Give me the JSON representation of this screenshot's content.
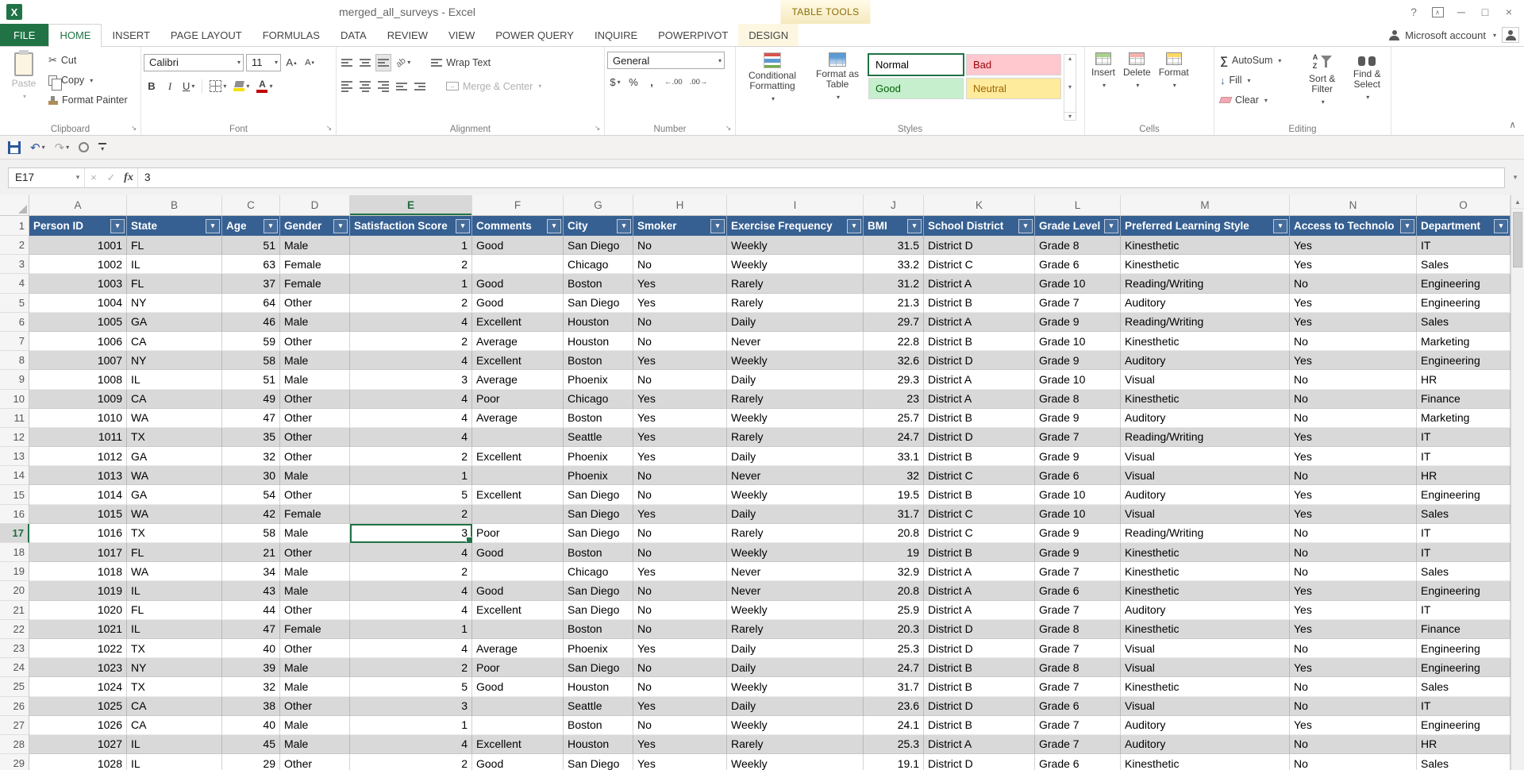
{
  "window": {
    "title": "merged_all_surveys - Excel",
    "context_header": "TABLE TOOLS"
  },
  "account_label": "Microsoft account",
  "tabs": {
    "file": "FILE",
    "items": [
      {
        "label": "HOME",
        "active": true
      },
      {
        "label": "INSERT"
      },
      {
        "label": "PAGE LAYOUT"
      },
      {
        "label": "FORMULAS"
      },
      {
        "label": "DATA"
      },
      {
        "label": "REVIEW"
      },
      {
        "label": "VIEW"
      },
      {
        "label": "POWER QUERY"
      },
      {
        "label": "INQUIRE"
      },
      {
        "label": "POWERPIVOT"
      },
      {
        "label": "DESIGN",
        "contextual": true
      }
    ]
  },
  "ribbon": {
    "clipboard": {
      "label": "Clipboard",
      "paste": "Paste",
      "cut": "Cut",
      "copy": "Copy",
      "format_painter": "Format Painter"
    },
    "font": {
      "label": "Font",
      "family": "Calibri",
      "size": "11",
      "bold": "B",
      "italic": "I",
      "underline": "U"
    },
    "alignment": {
      "label": "Alignment",
      "wr2": "",
      "wrap_text": "Wrap Text",
      "merge_center": "Merge & Center"
    },
    "number": {
      "label": "Number",
      "format": "General"
    },
    "styles": {
      "label": "Styles",
      "conditional": "Conditional Formatting",
      "format_table": "Format as Table",
      "gallery": [
        {
          "name": "Normal",
          "selected": true
        },
        {
          "name": "Bad"
        },
        {
          "name": "Good"
        },
        {
          "name": "Neutral"
        }
      ]
    },
    "cells": {
      "label": "Cells",
      "insert": "Insert",
      "delete": "Delete",
      "format": "Format"
    },
    "editing": {
      "label": "Editing",
      "autosum": "AutoSum",
      "fill": "Fill",
      "clear": "Clear",
      "sort_filter": "Sort & Filter",
      "find_select": "Find & Select"
    }
  },
  "formula_bar": {
    "name_box": "E17",
    "fx": "fx",
    "content": "3"
  },
  "sheet": {
    "col_letters": [
      "A",
      "B",
      "C",
      "D",
      "E",
      "F",
      "G",
      "H",
      "I",
      "J",
      "K",
      "L",
      "M",
      "N",
      "O"
    ],
    "selected_col": "E",
    "selected_row": 17,
    "table": {
      "headers": [
        "Person ID",
        "State",
        "Age",
        "Gender",
        "Satisfaction Score",
        "Comments",
        "City",
        "Smoker",
        "Exercise Frequency",
        "BMI",
        "School District",
        "Grade Level",
        "Preferred Learning Style",
        "Access to Technolo",
        "Department"
      ],
      "rows": [
        [
          1001,
          "FL",
          51,
          "Male",
          1,
          "Good",
          "San Diego",
          "No",
          "Weekly",
          31.5,
          "District D",
          "Grade 8",
          "Kinesthetic",
          "Yes",
          "IT"
        ],
        [
          1002,
          "IL",
          63,
          "Female",
          2,
          "",
          "Chicago",
          "No",
          "Weekly",
          33.2,
          "District C",
          "Grade 6",
          "Kinesthetic",
          "Yes",
          "Sales"
        ],
        [
          1003,
          "FL",
          37,
          "Female",
          1,
          "Good",
          "Boston",
          "Yes",
          "Rarely",
          31.2,
          "District A",
          "Grade 10",
          "Reading/Writing",
          "No",
          "Engineering"
        ],
        [
          1004,
          "NY",
          64,
          "Other",
          2,
          "Good",
          "San Diego",
          "Yes",
          "Rarely",
          21.3,
          "District B",
          "Grade 7",
          "Auditory",
          "Yes",
          "Engineering"
        ],
        [
          1005,
          "GA",
          46,
          "Male",
          4,
          "Excellent",
          "Houston",
          "No",
          "Daily",
          29.7,
          "District A",
          "Grade 9",
          "Reading/Writing",
          "Yes",
          "Sales"
        ],
        [
          1006,
          "CA",
          59,
          "Other",
          2,
          "Average",
          "Houston",
          "No",
          "Never",
          22.8,
          "District B",
          "Grade 10",
          "Kinesthetic",
          "No",
          "Marketing"
        ],
        [
          1007,
          "NY",
          58,
          "Male",
          4,
          "Excellent",
          "Boston",
          "Yes",
          "Weekly",
          32.6,
          "District D",
          "Grade 9",
          "Auditory",
          "Yes",
          "Engineering"
        ],
        [
          1008,
          "IL",
          51,
          "Male",
          3,
          "Average",
          "Phoenix",
          "No",
          "Daily",
          29.3,
          "District A",
          "Grade 10",
          "Visual",
          "No",
          "HR"
        ],
        [
          1009,
          "CA",
          49,
          "Other",
          4,
          "Poor",
          "Chicago",
          "Yes",
          "Rarely",
          23,
          "District A",
          "Grade 8",
          "Kinesthetic",
          "No",
          "Finance"
        ],
        [
          1010,
          "WA",
          47,
          "Other",
          4,
          "Average",
          "Boston",
          "Yes",
          "Weekly",
          25.7,
          "District B",
          "Grade 9",
          "Auditory",
          "No",
          "Marketing"
        ],
        [
          1011,
          "TX",
          35,
          "Other",
          4,
          "",
          "Seattle",
          "Yes",
          "Rarely",
          24.7,
          "District D",
          "Grade 7",
          "Reading/Writing",
          "Yes",
          "IT"
        ],
        [
          1012,
          "GA",
          32,
          "Other",
          2,
          "Excellent",
          "Phoenix",
          "Yes",
          "Daily",
          33.1,
          "District B",
          "Grade 9",
          "Visual",
          "Yes",
          "IT"
        ],
        [
          1013,
          "WA",
          30,
          "Male",
          1,
          "",
          "Phoenix",
          "No",
          "Never",
          32,
          "District C",
          "Grade 6",
          "Visual",
          "No",
          "HR"
        ],
        [
          1014,
          "GA",
          54,
          "Other",
          5,
          "Excellent",
          "San Diego",
          "No",
          "Weekly",
          19.5,
          "District B",
          "Grade 10",
          "Auditory",
          "Yes",
          "Engineering"
        ],
        [
          1015,
          "WA",
          42,
          "Female",
          2,
          "",
          "San Diego",
          "Yes",
          "Daily",
          31.7,
          "District C",
          "Grade 10",
          "Visual",
          "Yes",
          "Sales"
        ],
        [
          1016,
          "TX",
          58,
          "Male",
          3,
          "Poor",
          "San Diego",
          "No",
          "Rarely",
          20.8,
          "District C",
          "Grade 9",
          "Reading/Writing",
          "No",
          "IT"
        ],
        [
          1017,
          "FL",
          21,
          "Other",
          4,
          "Good",
          "Boston",
          "No",
          "Weekly",
          19,
          "District B",
          "Grade 9",
          "Kinesthetic",
          "No",
          "IT"
        ],
        [
          1018,
          "WA",
          34,
          "Male",
          2,
          "",
          "Chicago",
          "Yes",
          "Never",
          32.9,
          "District A",
          "Grade 7",
          "Kinesthetic",
          "No",
          "Sales"
        ],
        [
          1019,
          "IL",
          43,
          "Male",
          4,
          "Good",
          "San Diego",
          "No",
          "Never",
          20.8,
          "District A",
          "Grade 6",
          "Kinesthetic",
          "Yes",
          "Engineering"
        ],
        [
          1020,
          "FL",
          44,
          "Other",
          4,
          "Excellent",
          "San Diego",
          "No",
          "Weekly",
          25.9,
          "District A",
          "Grade 7",
          "Auditory",
          "Yes",
          "IT"
        ],
        [
          1021,
          "IL",
          47,
          "Female",
          1,
          "",
          "Boston",
          "No",
          "Rarely",
          20.3,
          "District D",
          "Grade 8",
          "Kinesthetic",
          "Yes",
          "Finance"
        ],
        [
          1022,
          "TX",
          40,
          "Other",
          4,
          "Average",
          "Phoenix",
          "Yes",
          "Daily",
          25.3,
          "District D",
          "Grade 7",
          "Visual",
          "No",
          "Engineering"
        ],
        [
          1023,
          "NY",
          39,
          "Male",
          2,
          "Poor",
          "San Diego",
          "No",
          "Daily",
          24.7,
          "District B",
          "Grade 8",
          "Visual",
          "Yes",
          "Engineering"
        ],
        [
          1024,
          "TX",
          32,
          "Male",
          5,
          "Good",
          "Houston",
          "No",
          "Weekly",
          31.7,
          "District B",
          "Grade 7",
          "Kinesthetic",
          "No",
          "Sales"
        ],
        [
          1025,
          "CA",
          38,
          "Other",
          3,
          "",
          "Seattle",
          "Yes",
          "Daily",
          23.6,
          "District D",
          "Grade 6",
          "Visual",
          "No",
          "IT"
        ],
        [
          1026,
          "CA",
          40,
          "Male",
          1,
          "",
          "Boston",
          "No",
          "Weekly",
          24.1,
          "District B",
          "Grade 7",
          "Auditory",
          "Yes",
          "Engineering"
        ],
        [
          1027,
          "IL",
          45,
          "Male",
          4,
          "Excellent",
          "Houston",
          "Yes",
          "Rarely",
          25.3,
          "District A",
          "Grade 7",
          "Auditory",
          "No",
          "HR"
        ],
        [
          1028,
          "IL",
          29,
          "Other",
          2,
          "Good",
          "San Diego",
          "Yes",
          "Weekly",
          19.1,
          "District D",
          "Grade 6",
          "Kinesthetic",
          "No",
          "Sales"
        ]
      ]
    }
  },
  "colors": {
    "excel_green": "#217346",
    "table_header_blue": "#366092",
    "band_gray": "#D9D9D9",
    "style_bad_bg": "#FFC7CE",
    "style_bad_fg": "#9C0006",
    "style_good_bg": "#C6EFCE",
    "style_good_fg": "#006100",
    "style_neutral_bg": "#FFEB9C",
    "style_neutral_fg": "#9C6500"
  }
}
